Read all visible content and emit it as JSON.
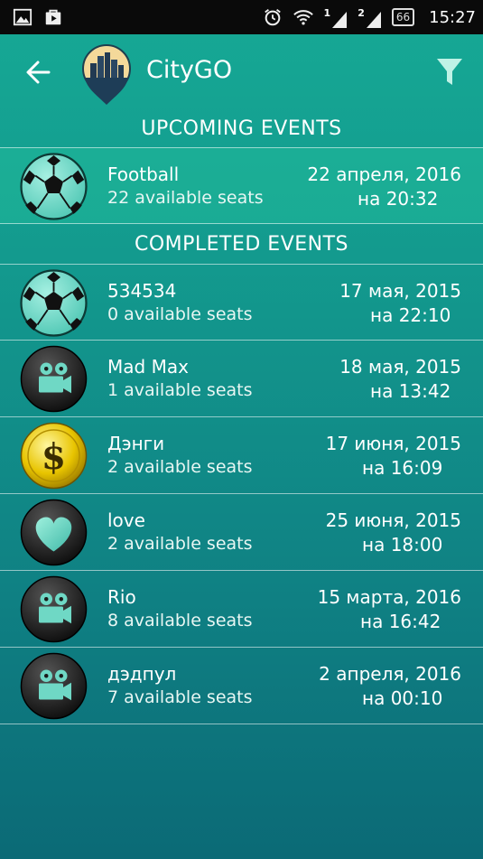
{
  "status_bar": {
    "time": "15:27",
    "battery": "66",
    "sim1": "1",
    "sim2": "2",
    "icons": [
      "image-icon",
      "play-store-icon",
      "alarm-icon",
      "wifi-icon",
      "signal-icon",
      "battery-icon"
    ]
  },
  "app_bar": {
    "title": "CityGO"
  },
  "sections": {
    "upcoming_title": "UPCOMING EVENTS",
    "completed_title": "COMPLETED EVENTS"
  },
  "upcoming": [
    {
      "name": "Football",
      "seats": "22 available seats",
      "date": "22 апреля, 2016",
      "time": "на 20:32",
      "icon": "soccer-ball-icon"
    }
  ],
  "completed": [
    {
      "name": "534534",
      "seats": "0 available seats",
      "date": "17 мая, 2015",
      "time": "на 22:10",
      "icon": "soccer-ball-icon"
    },
    {
      "name": "Mad Max",
      "seats": "1 available seats",
      "date": "18 мая, 2015",
      "time": "на 13:42",
      "icon": "movie-camera-icon"
    },
    {
      "name": "Дэнги",
      "seats": "2 available seats",
      "date": "17 июня, 2015",
      "time": "на 16:09",
      "icon": "dollar-coin-icon"
    },
    {
      "name": "love",
      "seats": "2 available seats",
      "date": "25 июня, 2015",
      "time": "на 18:00",
      "icon": "heart-icon"
    },
    {
      "name": "Rio",
      "seats": "8 available seats",
      "date": "15 марта, 2016",
      "time": "на 16:42",
      "icon": "movie-camera-icon"
    },
    {
      "name": "дэдпул",
      "seats": "7 available seats",
      "date": "2 апреля, 2016",
      "time": "на 00:10",
      "icon": "movie-camera-icon"
    }
  ],
  "colors": {
    "background_top": "#16a995",
    "background_bottom": "#0b6a76",
    "accent_teal": "#5fd9c6",
    "highlight_row": "#28c8a0"
  }
}
